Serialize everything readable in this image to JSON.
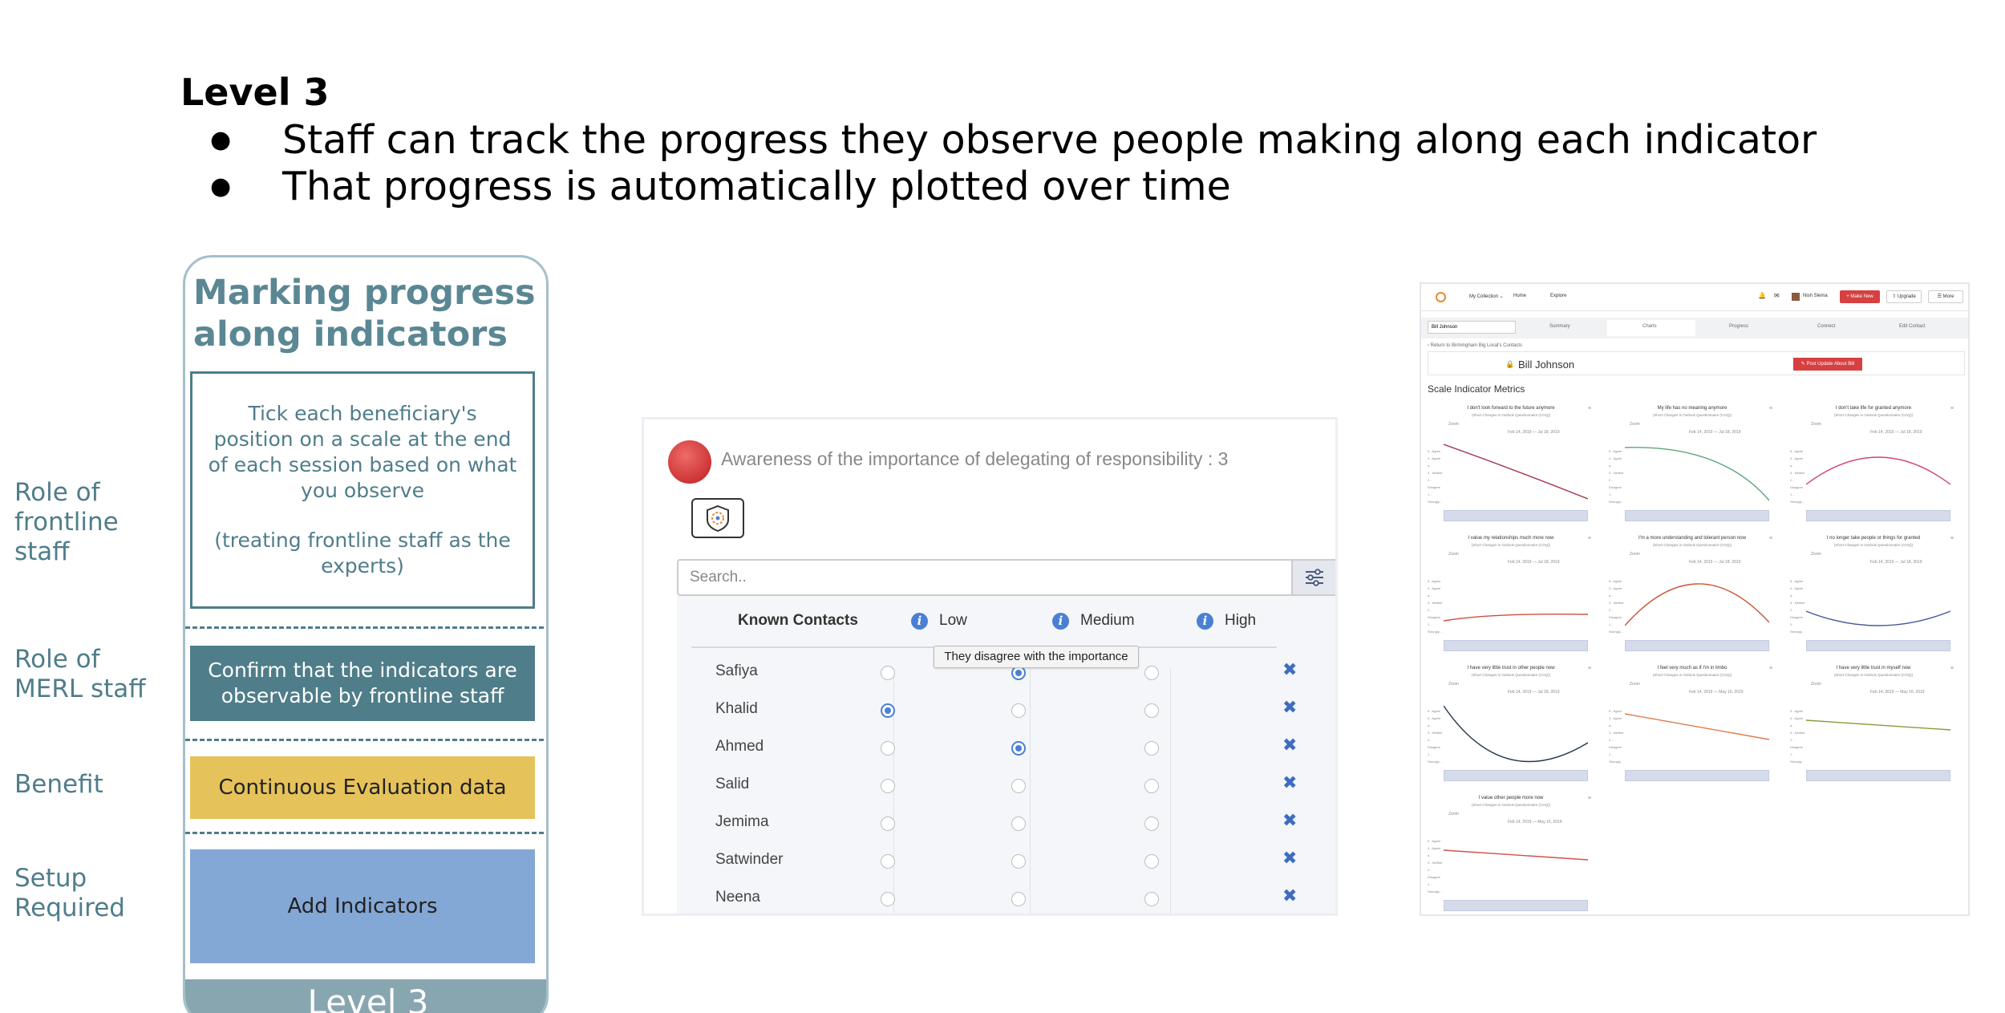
{
  "slide": {
    "title": "Level 3",
    "bullets": [
      "Staff can track the progress they observe people making along each indicator",
      "That progress is automatically plotted over time"
    ],
    "bullet_glyph": "●"
  },
  "roles": {
    "frontline": "Role of\nfrontline\nstaff",
    "merl": "Role of\nMERL staff",
    "benefit": "Benefit",
    "setup": "Setup\nRequired"
  },
  "card": {
    "title": "Marking progress\nalong indicators",
    "frontline_text": "Tick each beneficiary's position on a scale at the end of each session based on what you observe",
    "frontline_note": "(treating frontline staff as the experts)",
    "merl_text": "Confirm that the indicators are observable by frontline staff",
    "benefit_text": "Continuous Evaluation data",
    "setup_text": "Add Indicators",
    "footer": "Level 3",
    "colors": {
      "teal": "#4f7d8a",
      "gold": "#e6c25a",
      "blue": "#84a8d5",
      "footer": "#88a6b0"
    }
  },
  "tracker": {
    "indicator_title": "Awareness of the importance of delegating of responsibility : 3",
    "search_placeholder": "Search..",
    "columns": {
      "contacts": "Known Contacts",
      "low": "Low",
      "medium": "Medium",
      "high": "High"
    },
    "tooltip": "They disagree with the importance",
    "remove_glyph": "✖",
    "accent": "#4a7fd4",
    "rows": [
      {
        "name": "Safiya",
        "selected": "medium"
      },
      {
        "name": "Khalid",
        "selected": "low"
      },
      {
        "name": "Ahmed",
        "selected": "medium"
      },
      {
        "name": "Salid",
        "selected": ""
      },
      {
        "name": "Jemima",
        "selected": ""
      },
      {
        "name": "Satwinder",
        "selected": ""
      },
      {
        "name": "Neena",
        "selected": ""
      }
    ]
  },
  "dashboard": {
    "nav": {
      "collection": "My Collection ⌄",
      "home": "Home",
      "explore": "Explore",
      "user": "Nish Slema",
      "make_new": "+ Make New",
      "upgrade": "⇧ Upgrade",
      "more": "☰ More"
    },
    "contact_select": "Bill Johnson",
    "tabs": [
      "Summary",
      "Charts",
      "Progress",
      "Connect",
      "Edit Contact"
    ],
    "breadcrumb": "‹ Return to Birmingham Big Local's Contacts",
    "client_name": "Bill Johnson",
    "post_update": "✎ Post Update About Bill",
    "section_title": "Scale Indicator Metrics",
    "panel_sub": "(Short Changes in Outlook Questionnaire (COQ))",
    "zoom_label": "Zoom",
    "y_labels": [
      "5 - Agree",
      "4 - Agree a..",
      "3 - Neither",
      "2 - Disagree",
      "1 - Strongly..."
    ],
    "panels": [
      {
        "title": "I don't look forward to the future anymore",
        "from": "Feb 14, 2019",
        "to": "Jul 18, 2019",
        "shape": "down",
        "color": "#a2334a"
      },
      {
        "title": "My life has no meaning anymore",
        "from": "Feb 14, 2019",
        "to": "Jul 18, 2019",
        "shape": "drop",
        "color": "#5aa67a"
      },
      {
        "title": "I don't take life for granted anymore",
        "from": "Feb 14, 2019",
        "to": "Jul 18, 2019",
        "shape": "arch",
        "color": "#d0476a"
      },
      {
        "title": "I value my relationships much more now",
        "from": "Feb 14, 2019",
        "to": "Jul 18, 2019",
        "shape": "flat-rise",
        "color": "#cc5040"
      },
      {
        "title": "I'm a more understanding and tolerant person now",
        "from": "Feb 14, 2019",
        "to": "Jul 18, 2019",
        "shape": "peak",
        "color": "#cc5533"
      },
      {
        "title": "I no longer take people or things for granted",
        "from": "Feb 14, 2019",
        "to": "Jul 18, 2019",
        "shape": "bowl",
        "color": "#4a5a9a"
      },
      {
        "title": "I have very little trust in other people now",
        "from": "Feb 14, 2019",
        "to": "Jul 18, 2019",
        "shape": "valley",
        "color": "#2a3850"
      },
      {
        "title": "I feel very much as if I'm in limbo",
        "from": "Feb 14, 2019",
        "to": "May 16, 2019",
        "shape": "line-down",
        "color": "#e07a4a"
      },
      {
        "title": "I have very little trust in myself now",
        "from": "Feb 14, 2019",
        "to": "May 16, 2019",
        "shape": "line-slight",
        "color": "#8a9a3a"
      },
      {
        "title": "I value other people more now",
        "from": "Feb 14, 2019",
        "to": "May 16, 2019",
        "shape": "line-slight",
        "color": "#d05050"
      }
    ]
  }
}
